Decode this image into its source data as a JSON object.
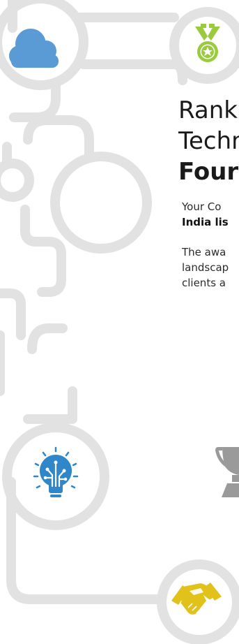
{
  "colors": {
    "path_gray": "#e2e2e2",
    "cloud_blue": "#5b9bd5",
    "medal_green": "#9acb3c",
    "bulb_blue": "#2f86c9",
    "hands_yellow": "#e0c21a",
    "trophy_gray": "#9a9a9a"
  },
  "icons": [
    "cloud-icon",
    "medal-icon",
    "lightbulb-icon",
    "trophy-icon",
    "handshake-icon"
  ],
  "heading": {
    "line1": "Rank",
    "line2": "Techn",
    "line3": "Four"
  },
  "intro": {
    "line1": "Your Co",
    "line2_bold": "India lis"
  },
  "body": {
    "line1": "The awa",
    "line2": "landscap",
    "line3": "clients a"
  }
}
